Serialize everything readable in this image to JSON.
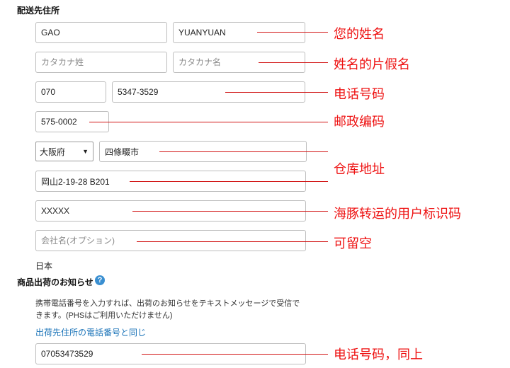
{
  "section_title": "配送先住所",
  "fields": {
    "last_name": {
      "value": "GAO",
      "placeholder": ""
    },
    "first_name": {
      "value": "YUANYUAN",
      "placeholder": ""
    },
    "last_name_kana": {
      "value": "",
      "placeholder": "カタカナ姓"
    },
    "first_name_kana": {
      "value": "",
      "placeholder": "カタカナ名"
    },
    "phone_area": {
      "value": "070",
      "placeholder": ""
    },
    "phone_number": {
      "value": "5347-3529",
      "placeholder": ""
    },
    "postal_code": {
      "value": "575-0002",
      "placeholder": ""
    },
    "prefecture": {
      "selected": "大阪府"
    },
    "city": {
      "value": "四條畷市",
      "placeholder": ""
    },
    "address_line": {
      "value": "岡山2-19-28 B201",
      "placeholder": ""
    },
    "user_code": {
      "value": "XXXXX",
      "placeholder": ""
    },
    "company": {
      "value": "",
      "placeholder": "会社名(オプション)"
    },
    "notify_phone": {
      "value": "07053473529",
      "placeholder": ""
    }
  },
  "country": "日本",
  "notify": {
    "title": "商品出荷のお知らせ",
    "help_icon": "help-icon",
    "description_line1": "携帯電話番号を入力すれば、出荷のお知らせをテキストメッセージで受信で",
    "description_line2": "きます。(PHSはご利用いただけません)",
    "link": "出荷先住所の電話番号と同じ"
  },
  "annotations": {
    "name": "您的姓名",
    "kana": "姓名的片假名",
    "phone": "电话号码",
    "postal": "邮政编码",
    "warehouse": "仓库地址",
    "user_code": "海豚转运的用户标识码",
    "optional": "可留空",
    "phone_same": "电话号码，同上"
  },
  "colors": {
    "annotation": "#e11111",
    "link": "#1a73b8",
    "help": "#3a8fd1"
  }
}
